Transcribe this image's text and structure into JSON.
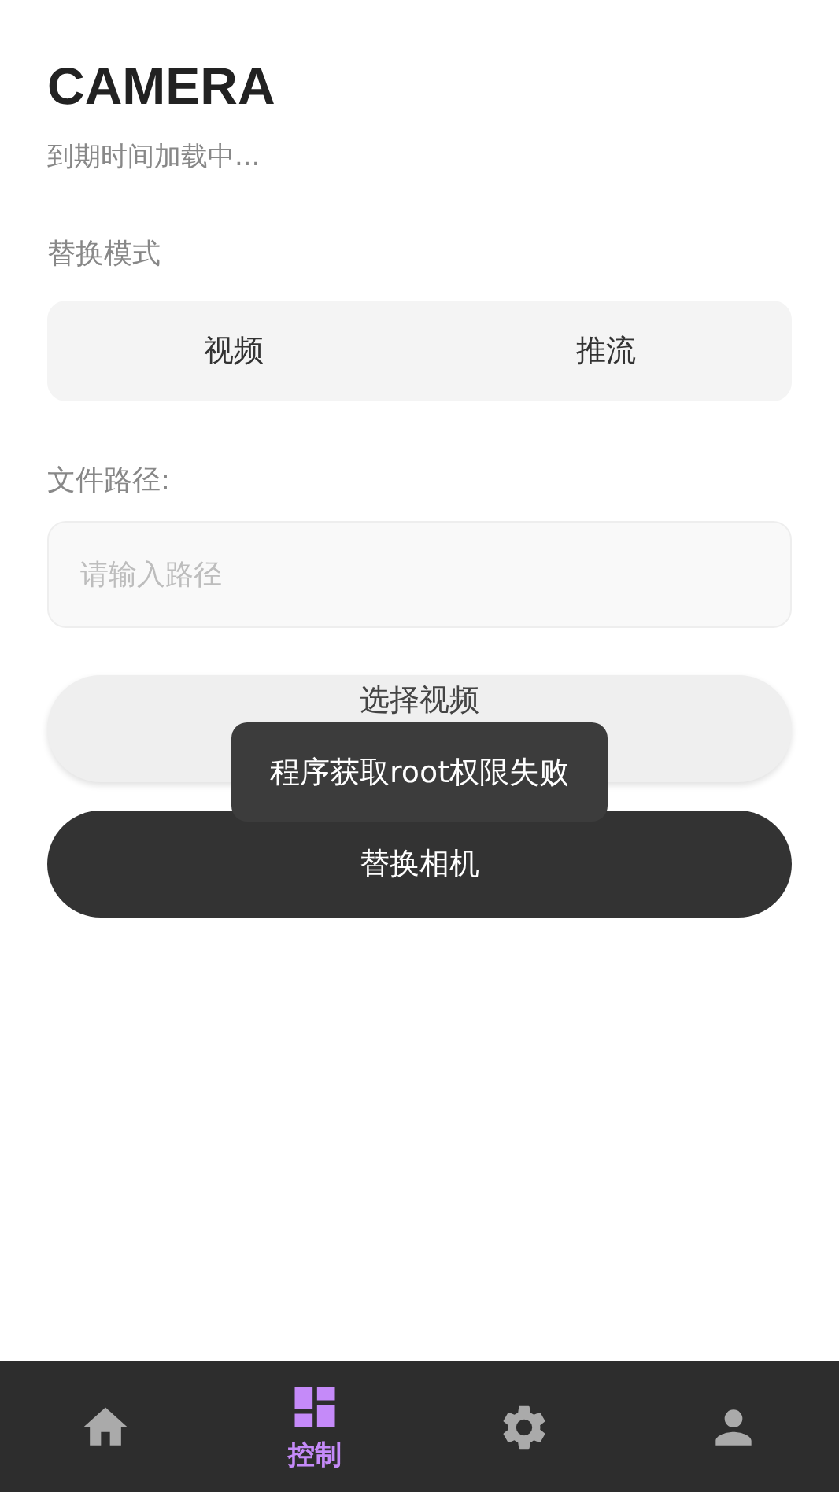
{
  "title": "CAMERA",
  "subtitle": "到期时间加载中...",
  "mode": {
    "label": "替换模式",
    "options": [
      {
        "label": "视频",
        "selected": false
      },
      {
        "label": "推流",
        "selected": false
      }
    ]
  },
  "path": {
    "label": "文件路径:",
    "placeholder": "请输入路径"
  },
  "buttons": {
    "select": "选择视频",
    "replace": "替换相机"
  },
  "toast": "程序获取root权限失败",
  "nav": [
    {
      "kind": "home",
      "selected": false
    },
    {
      "kind": "control",
      "label": "控制",
      "selected": true
    },
    {
      "kind": "settings",
      "selected": false
    },
    {
      "kind": "profile",
      "selected": false
    }
  ]
}
